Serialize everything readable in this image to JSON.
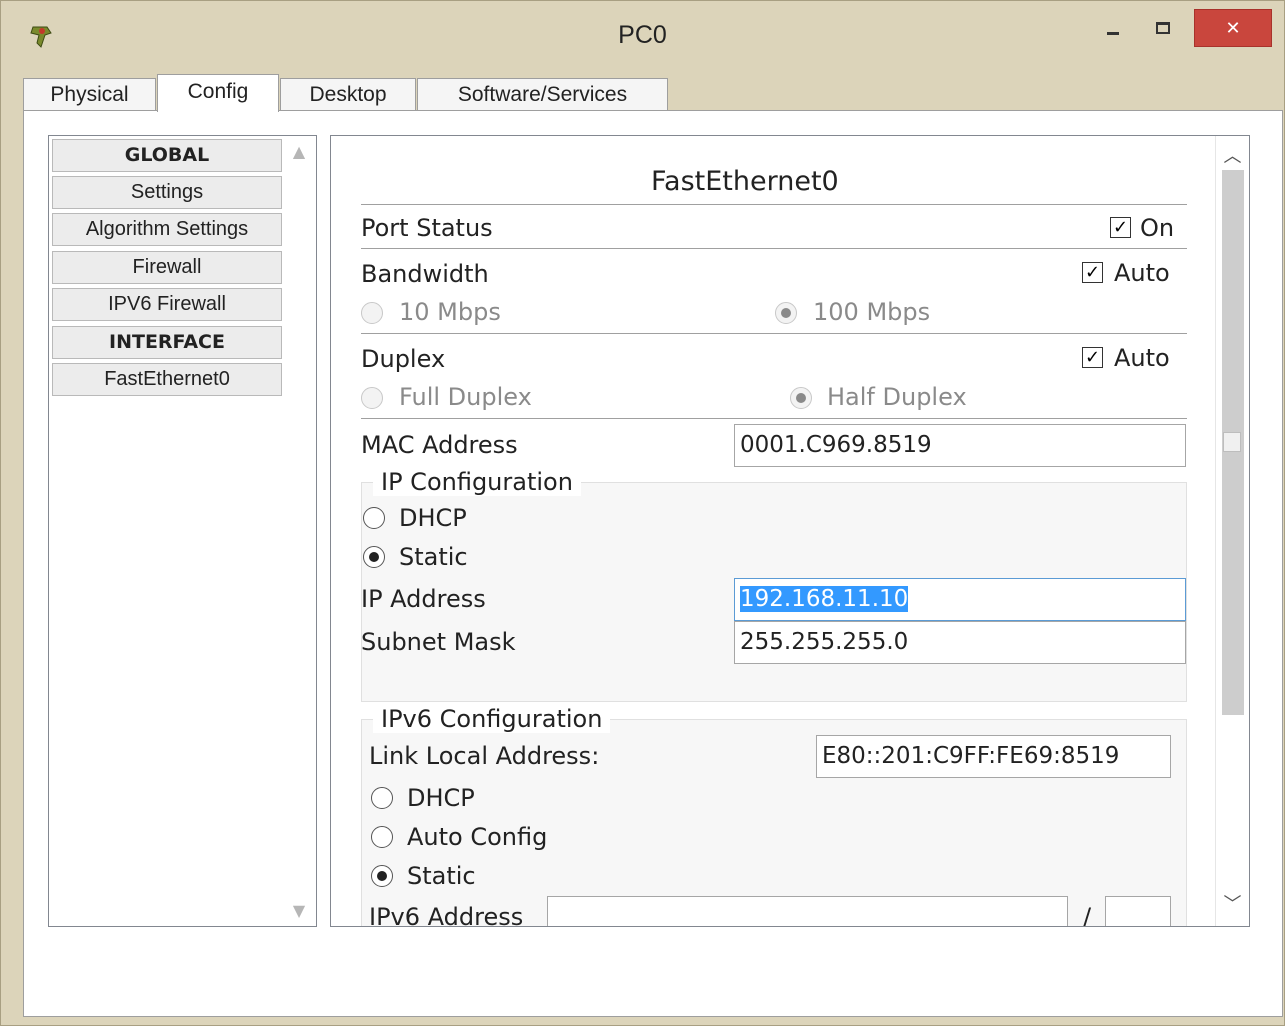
{
  "window": {
    "title": "PC0",
    "close_glyph": "✕",
    "accent_close": "#c9463d",
    "background": "#dcd4ba"
  },
  "tabs": [
    {
      "label": "Physical",
      "active": false
    },
    {
      "label": "Config",
      "active": true
    },
    {
      "label": "Desktop",
      "active": false
    },
    {
      "label": "Software/Services",
      "active": false
    }
  ],
  "sidebar": {
    "items": [
      {
        "label": "GLOBAL",
        "header": true
      },
      {
        "label": "Settings",
        "header": false
      },
      {
        "label": "Algorithm Settings",
        "header": false
      },
      {
        "label": "Firewall",
        "header": false
      },
      {
        "label": "IPV6 Firewall",
        "header": false
      },
      {
        "label": "INTERFACE",
        "header": true
      },
      {
        "label": "FastEthernet0",
        "header": false
      }
    ]
  },
  "interface": {
    "title": "FastEthernet0",
    "port_status": {
      "label": "Port Status",
      "checkbox_label": "On",
      "checked": true
    },
    "bandwidth": {
      "label": "Bandwidth",
      "auto_label": "Auto",
      "auto_checked": true,
      "options": [
        {
          "label": "10 Mbps",
          "selected": false
        },
        {
          "label": "100 Mbps",
          "selected": true
        }
      ]
    },
    "duplex": {
      "label": "Duplex",
      "auto_label": "Auto",
      "auto_checked": true,
      "options": [
        {
          "label": "Full Duplex",
          "selected": false
        },
        {
          "label": "Half Duplex",
          "selected": true
        }
      ]
    },
    "mac": {
      "label": "MAC Address",
      "value": "0001.C969.8519"
    },
    "ip_config": {
      "title": "IP Configuration",
      "dhcp_label": "DHCP",
      "static_label": "Static",
      "mode": "Static",
      "ip_label": "IP Address",
      "ip_value": "192.168.11.10",
      "mask_label": "Subnet Mask",
      "mask_value": "255.255.255.0"
    },
    "ipv6_config": {
      "title": "IPv6 Configuration",
      "link_local_label": "Link Local Address:",
      "link_local_value": "E80::201:C9FF:FE69:8519",
      "dhcp_label": "DHCP",
      "auto_label": "Auto Config",
      "static_label": "Static",
      "mode": "Static",
      "address_label": "IPv6 Address",
      "address_value": "",
      "prefix_separator": "/",
      "prefix_value": ""
    }
  }
}
